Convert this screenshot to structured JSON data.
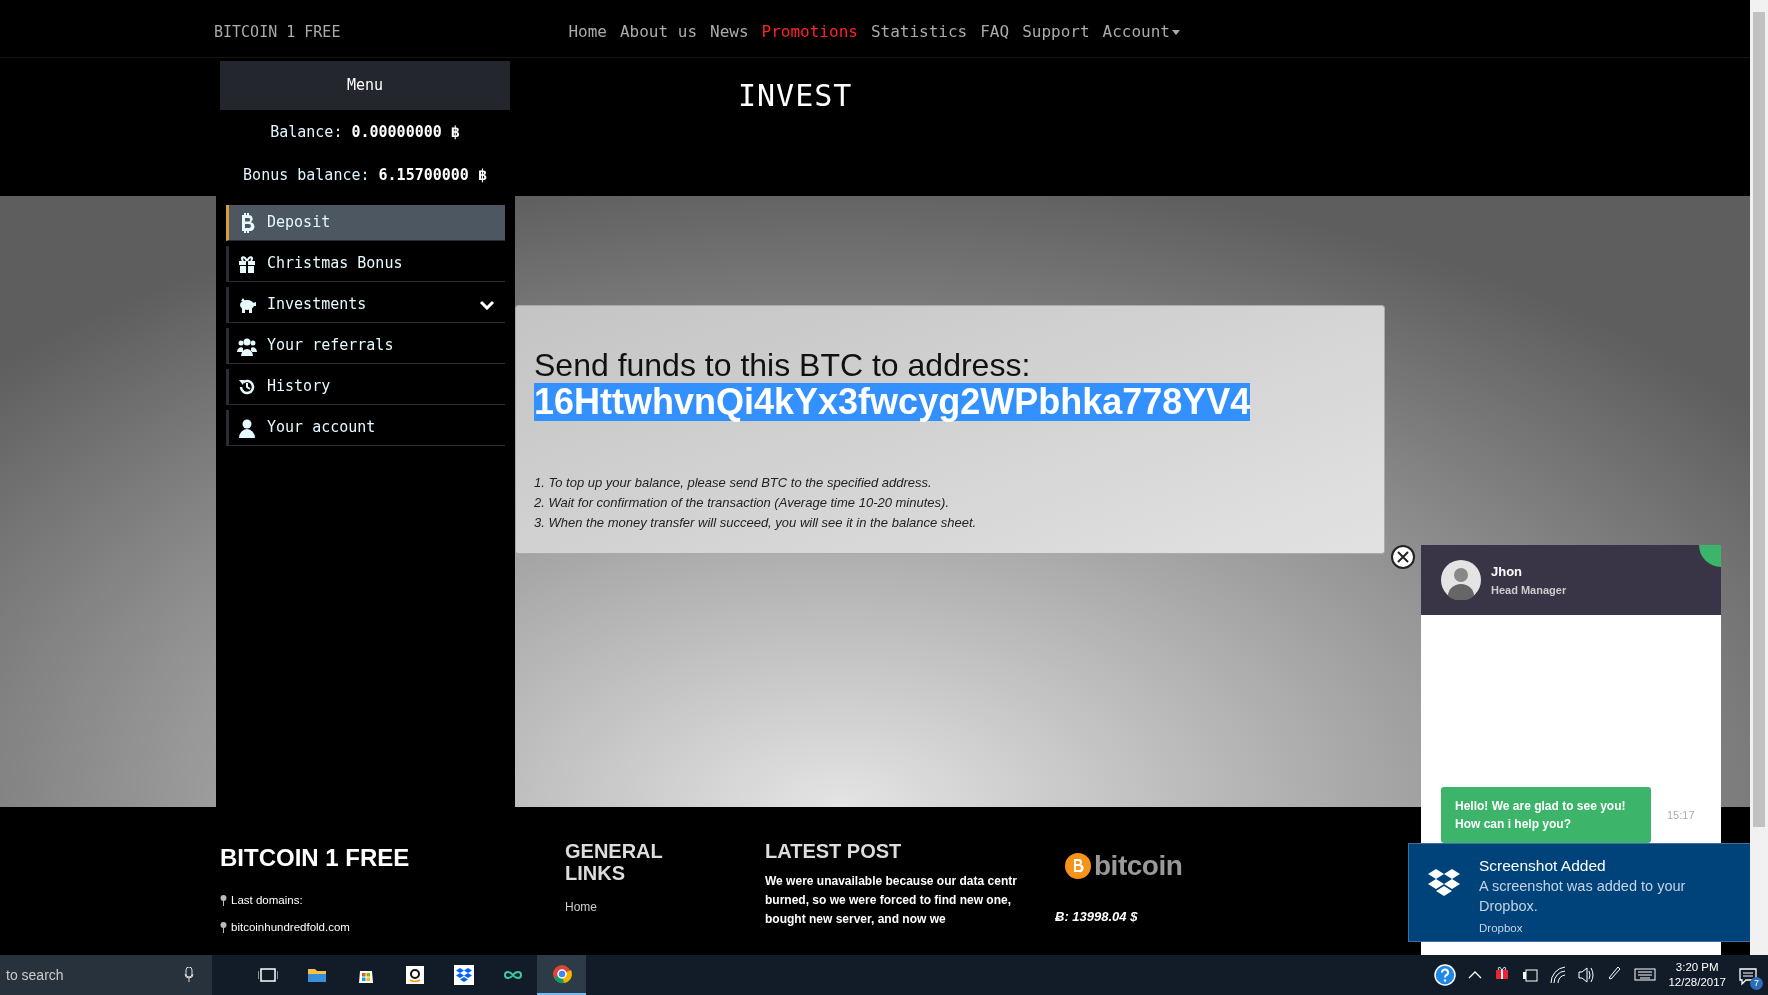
{
  "top_nav": {
    "brand": "BITCOIN 1 FREE",
    "links": [
      {
        "label": "Home",
        "selected": false,
        "dropdown": false
      },
      {
        "label": "About us",
        "selected": false,
        "dropdown": false
      },
      {
        "label": "News",
        "selected": false,
        "dropdown": false
      },
      {
        "label": "Promotions",
        "selected": true,
        "dropdown": false
      },
      {
        "label": "Statistics",
        "selected": false,
        "dropdown": false
      },
      {
        "label": "FAQ",
        "selected": false,
        "dropdown": false
      },
      {
        "label": "Support",
        "selected": false,
        "dropdown": false
      },
      {
        "label": "Account",
        "selected": false,
        "dropdown": true
      }
    ]
  },
  "sidebar": {
    "menu_button": "Menu",
    "balances": [
      "Balance: **0.00000000 ฿**",
      "Bonus balance: **6.15700000 ฿**"
    ],
    "items": [
      {
        "label": "Deposit",
        "selected": true,
        "has_submenu": false
      },
      {
        "label": "Christmas Bonus",
        "selected": false,
        "has_submenu": false
      },
      {
        "label": "Investments",
        "selected": false,
        "has_submenu": true
      },
      {
        "label": "Your referrals",
        "selected": false,
        "has_submenu": false
      },
      {
        "label": "History",
        "selected": false,
        "has_submenu": false
      },
      {
        "label": "Your account",
        "selected": false,
        "has_submenu": false
      }
    ]
  },
  "page_title": "INVEST",
  "deposit_dialog": {
    "heading": "Send funds to this BTC to address:",
    "address": "16HttwhvnQi4kYx3fwcyg2WPbhka778YV4",
    "address_selected": true,
    "steps": [
      "1. To top up your balance, please send BTC to the specified address.",
      "2. Wait for confirmation of the transaction (Average time 10-20 minutes).",
      "3. When the money transfer will succeed, you will see it in the balance sheet."
    ]
  },
  "chat": {
    "agent_name": "Jhon",
    "agent_role": "Head Manager",
    "online": true,
    "messages": [
      {
        "text": "Hello! We are glad to see you! How can i help you?",
        "time": "15:17"
      }
    ]
  },
  "footer": {
    "brand": "BITCOIN 1 FREE",
    "domains_label": "Last domains:",
    "domains": [
      "bitcoinhundredfold.com"
    ],
    "links_heading": "GENERAL LINKS",
    "links": [
      "Home"
    ],
    "post_heading": "LATEST POST",
    "post_text": "We were unavailable because our data centr burned, so we were forced to find new one, bought new server, and now we",
    "logo_text": "bitcoin",
    "price": "Ƀ: 13998.04 $"
  },
  "notification": {
    "title": "Screenshot Added",
    "body": "A screenshot was added to your Dropbox.",
    "source": "Dropbox"
  },
  "taskbar": {
    "search_placeholder": "to search",
    "apps": [
      {
        "selected": false
      },
      {
        "selected": false
      },
      {
        "selected": false
      },
      {
        "selected": false
      },
      {
        "selected": false
      },
      {
        "selected": false
      },
      {
        "selected": true
      }
    ],
    "time": "3:20 PM",
    "date": "12/28/2017",
    "notification_count": "7"
  }
}
